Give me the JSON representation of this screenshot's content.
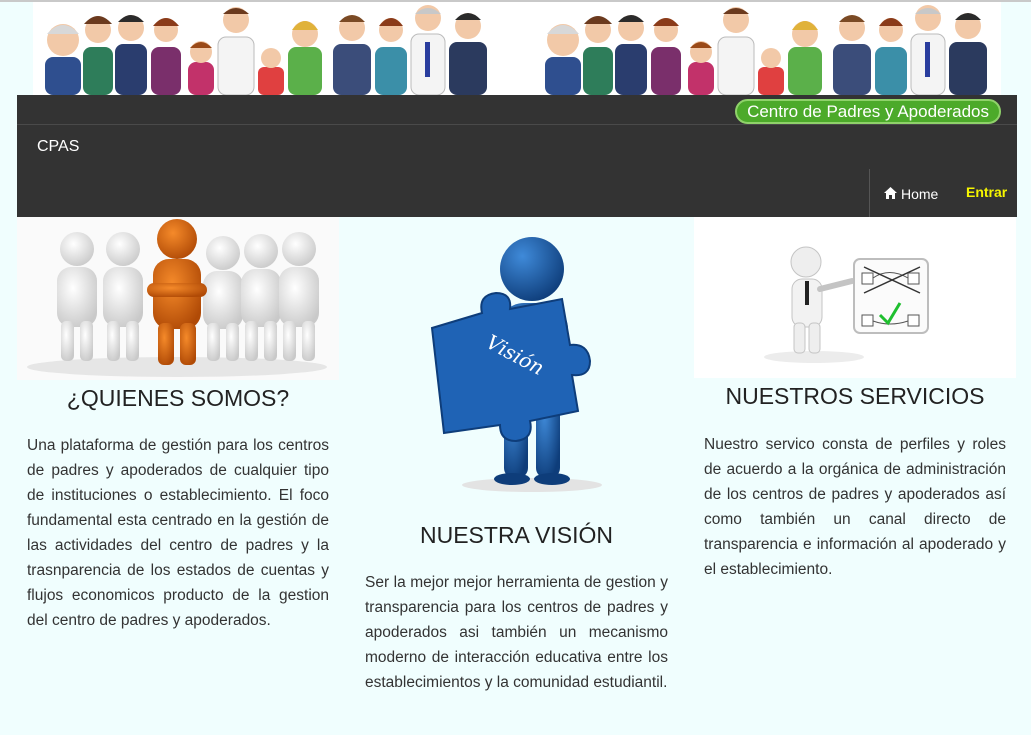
{
  "header": {
    "badge": "Centro de Padres y Apoderados",
    "brand": "CPAS",
    "nav": {
      "home": "Home",
      "login": "Entrar"
    }
  },
  "columns": [
    {
      "title": "¿QUIENES SOMOS?",
      "text": "Una plataforma de gestión para los centros de padres y apoderados de cualquier tipo de instituciones o establecimiento. El foco fundamental esta centrado en la gestión de las actividades del centro de padres y la trasnparencia de los estados de cuentas y flujos economicos producto de la gestion del centro de padres y apoderados."
    },
    {
      "title": "NUESTRA VISIÓN",
      "image_caption": "Visión",
      "text": "Ser la mejor mejor herramienta de gestion y transparencia para los centros de padres y apoderados asi también un mecanismo moderno de interacción educativa entre los establecimientos y la comunidad estudiantil."
    },
    {
      "title": "NUESTROS SERVICIOS",
      "text": "Nuestro servico consta de perfiles y roles de acuerdo a la orgánica de administración de los centros de padres y apoderados así como también un canal directo de transparencia e información al apoderado y el establecimiento."
    }
  ],
  "colors": {
    "navbar": "#333333",
    "badge": "#4caa2a",
    "login": "#f5f500",
    "page": "#f0fefe"
  }
}
